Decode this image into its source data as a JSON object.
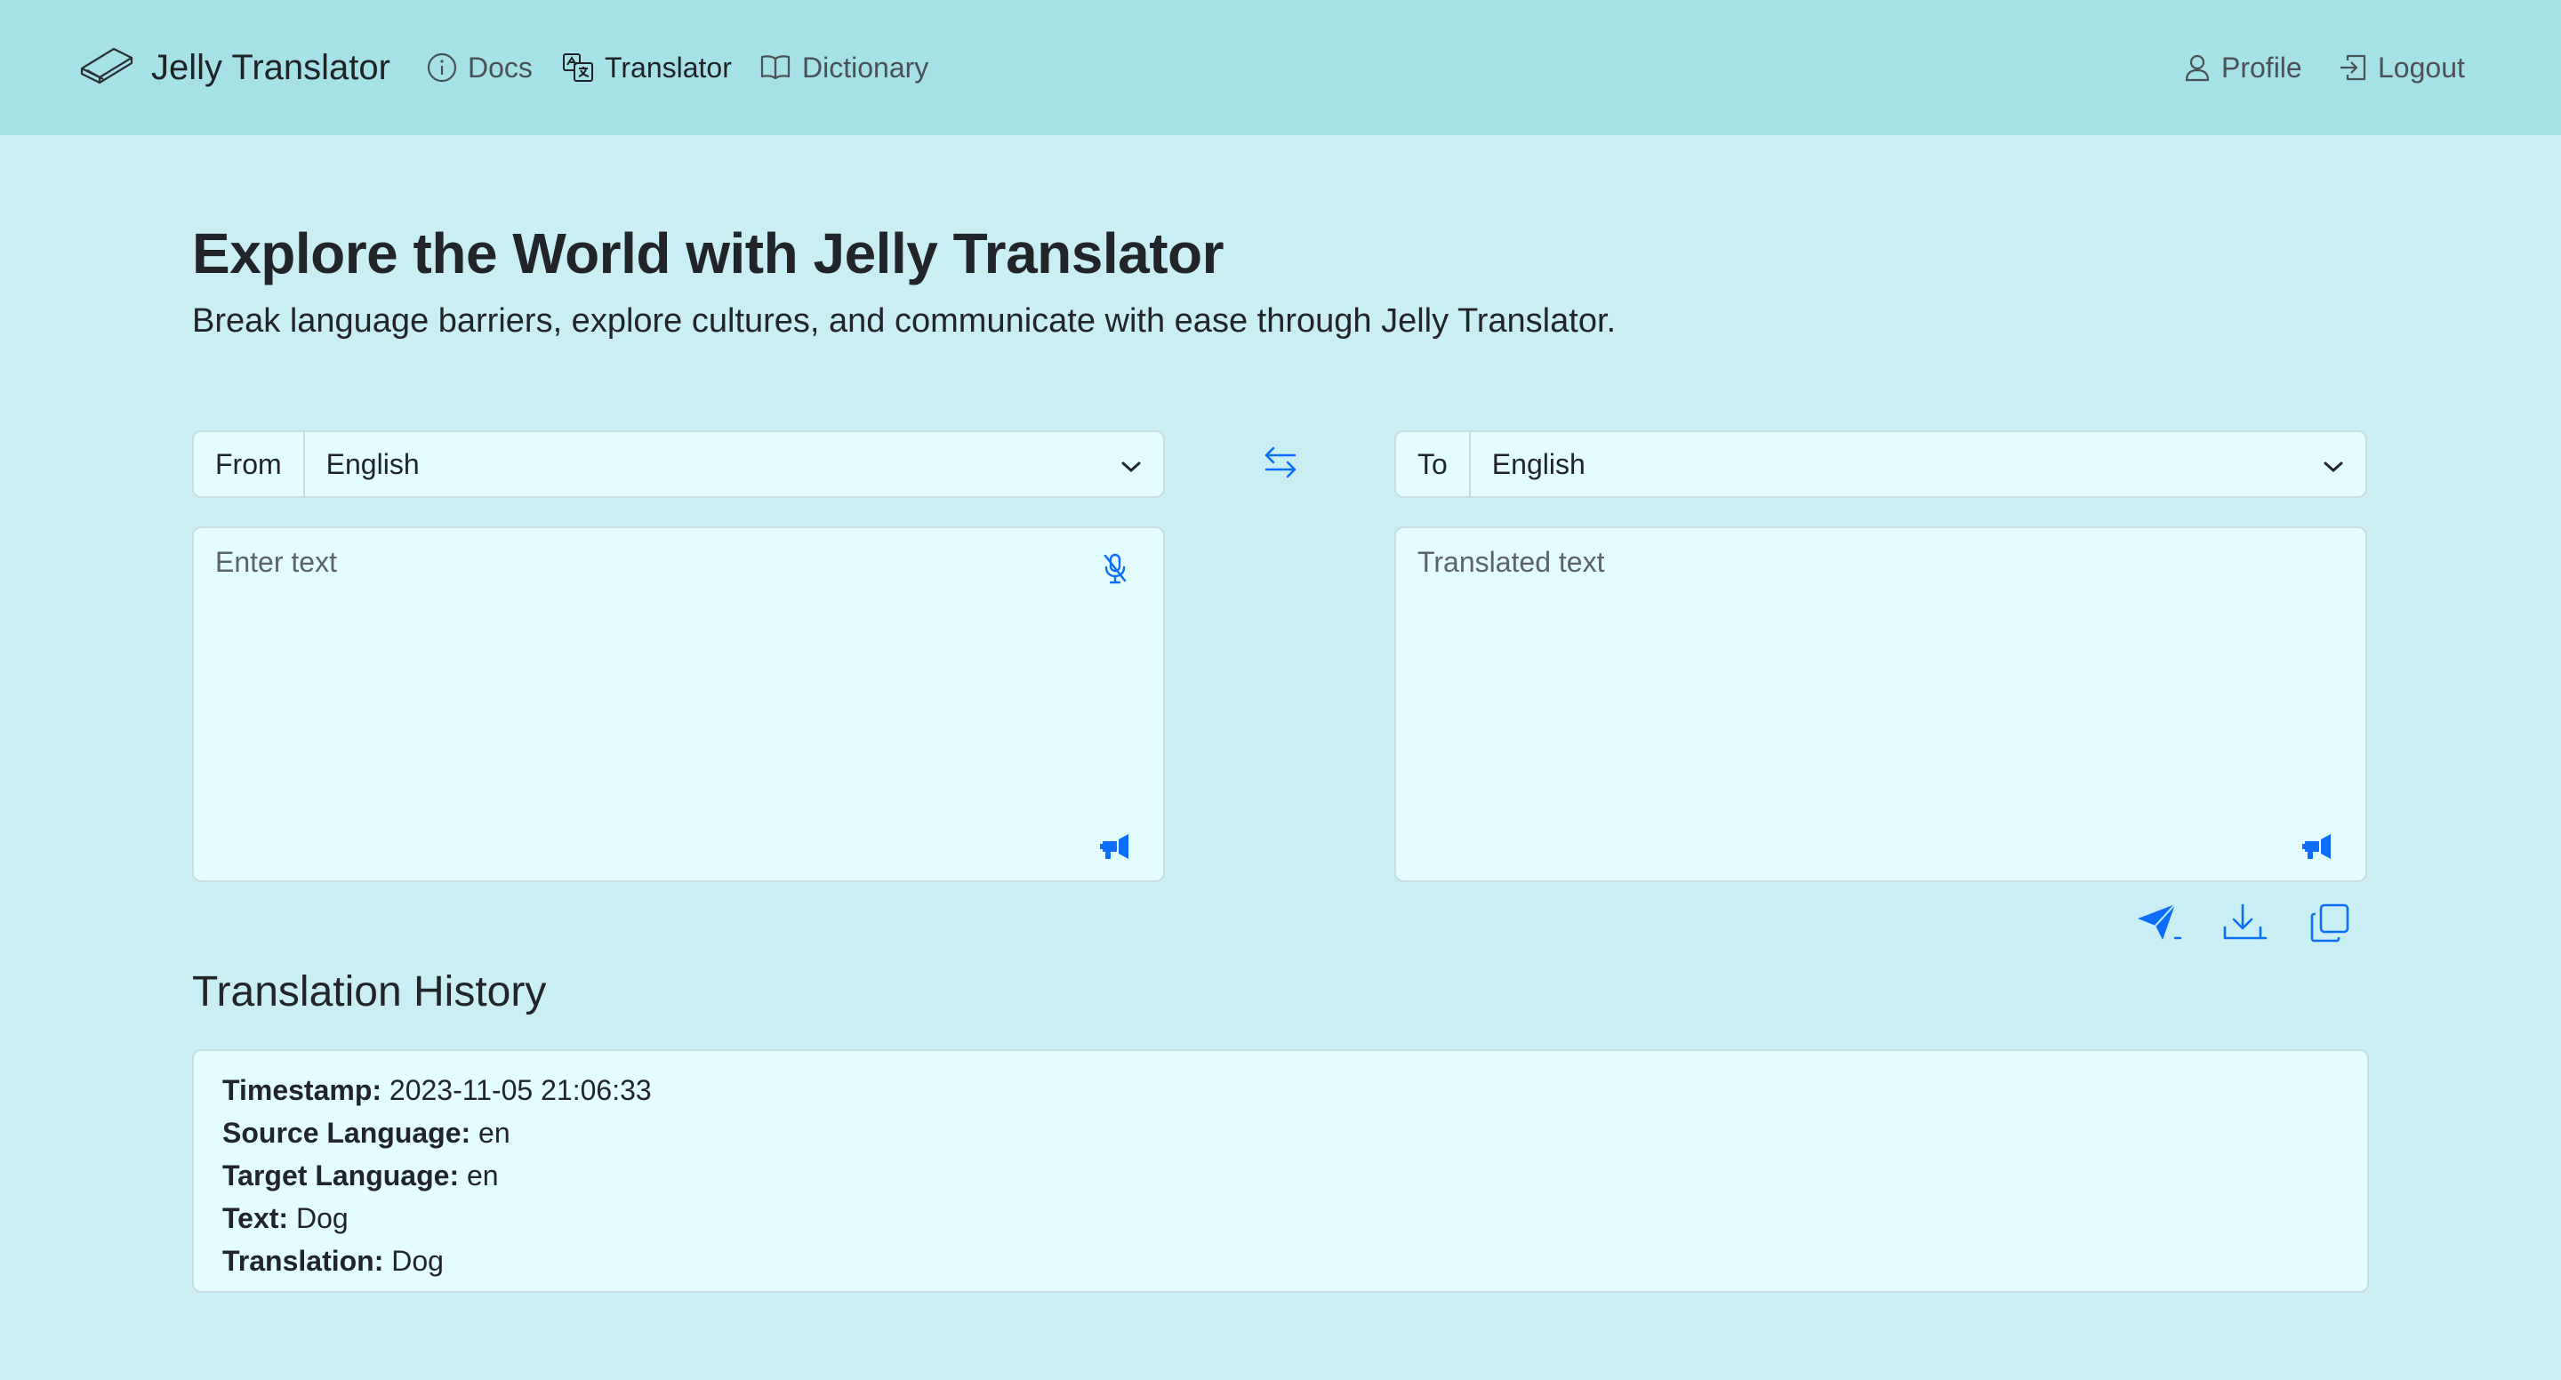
{
  "navbar": {
    "brand": "Jelly Translator",
    "links": {
      "docs": "Docs",
      "translator": "Translator",
      "dictionary": "Dictionary",
      "profile": "Profile",
      "logout": "Logout"
    }
  },
  "hero": {
    "title": "Explore the World with Jelly Translator",
    "subtitle": "Break language barriers, explore cultures, and communicate with ease through Jelly Translator."
  },
  "source": {
    "label": "From",
    "language": "English",
    "placeholder": "Enter text"
  },
  "target": {
    "label": "To",
    "language": "English",
    "placeholder": "Translated text"
  },
  "history": {
    "title": "Translation History",
    "entries": [
      {
        "timestamp_label": "Timestamp:",
        "timestamp": "2023-11-05 21:06:33",
        "source_label": "Source Language:",
        "source": "en",
        "target_label": "Target Language:",
        "target": "en",
        "text_label": "Text:",
        "text": "Dog",
        "translation_label": "Translation:",
        "translation": "Dog"
      }
    ]
  },
  "icons": {
    "brand": "eraser-logo-icon",
    "docs": "info-circle-icon",
    "translator": "translate-icon",
    "dictionary": "book-icon",
    "profile": "person-icon",
    "logout": "box-arrow-in-right-icon",
    "swap": "swap-arrows-icon",
    "mic": "mic-mute-icon",
    "speak": "megaphone-icon",
    "send": "send-icon",
    "download": "download-icon",
    "copy": "copy-icon"
  },
  "colors": {
    "navbar_bg": "#a6e1e8",
    "page_bg": "#c9eff4",
    "panel_bg": "#e3fcfd",
    "accent": "#0d6efd"
  }
}
